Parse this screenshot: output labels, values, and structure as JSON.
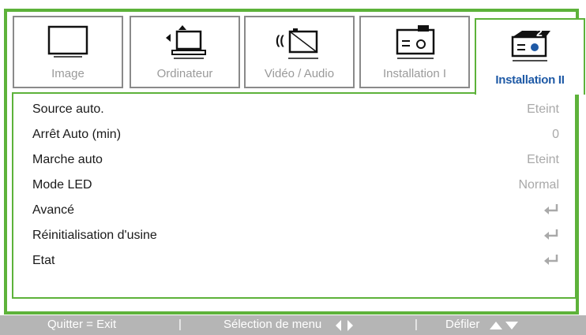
{
  "tabs": [
    {
      "label": "Image",
      "icon": "image-icon"
    },
    {
      "label": "Ordinateur",
      "icon": "computer-icon"
    },
    {
      "label": "Vidéo / Audio",
      "icon": "video-audio-icon"
    },
    {
      "label": "Installation I",
      "icon": "projector-icon"
    },
    {
      "label": "Installation II",
      "icon": "projector-2-icon",
      "active": true
    }
  ],
  "menu": {
    "items": [
      {
        "name": "Source auto.",
        "value": "Eteint"
      },
      {
        "name": "Arrêt Auto (min)",
        "value": "0"
      },
      {
        "name": "Marche auto",
        "value": "Eteint"
      },
      {
        "name": "Mode LED",
        "value": "Normal"
      },
      {
        "name": "Avancé",
        "value": "",
        "icon": "enter-icon"
      },
      {
        "name": "Réinitialisation d'usine",
        "value": "",
        "icon": "enter-icon"
      },
      {
        "name": "Etat",
        "value": "",
        "icon": "enter-icon"
      }
    ]
  },
  "footer": {
    "exit": "Quitter = Exit",
    "sep1": "|",
    "select": "Sélection de menu",
    "sep2": "|",
    "scroll": "Défiler"
  },
  "colors": {
    "accent": "#5db23a",
    "active_text": "#1f5aa6",
    "footer_bg": "#b5b5b5"
  }
}
